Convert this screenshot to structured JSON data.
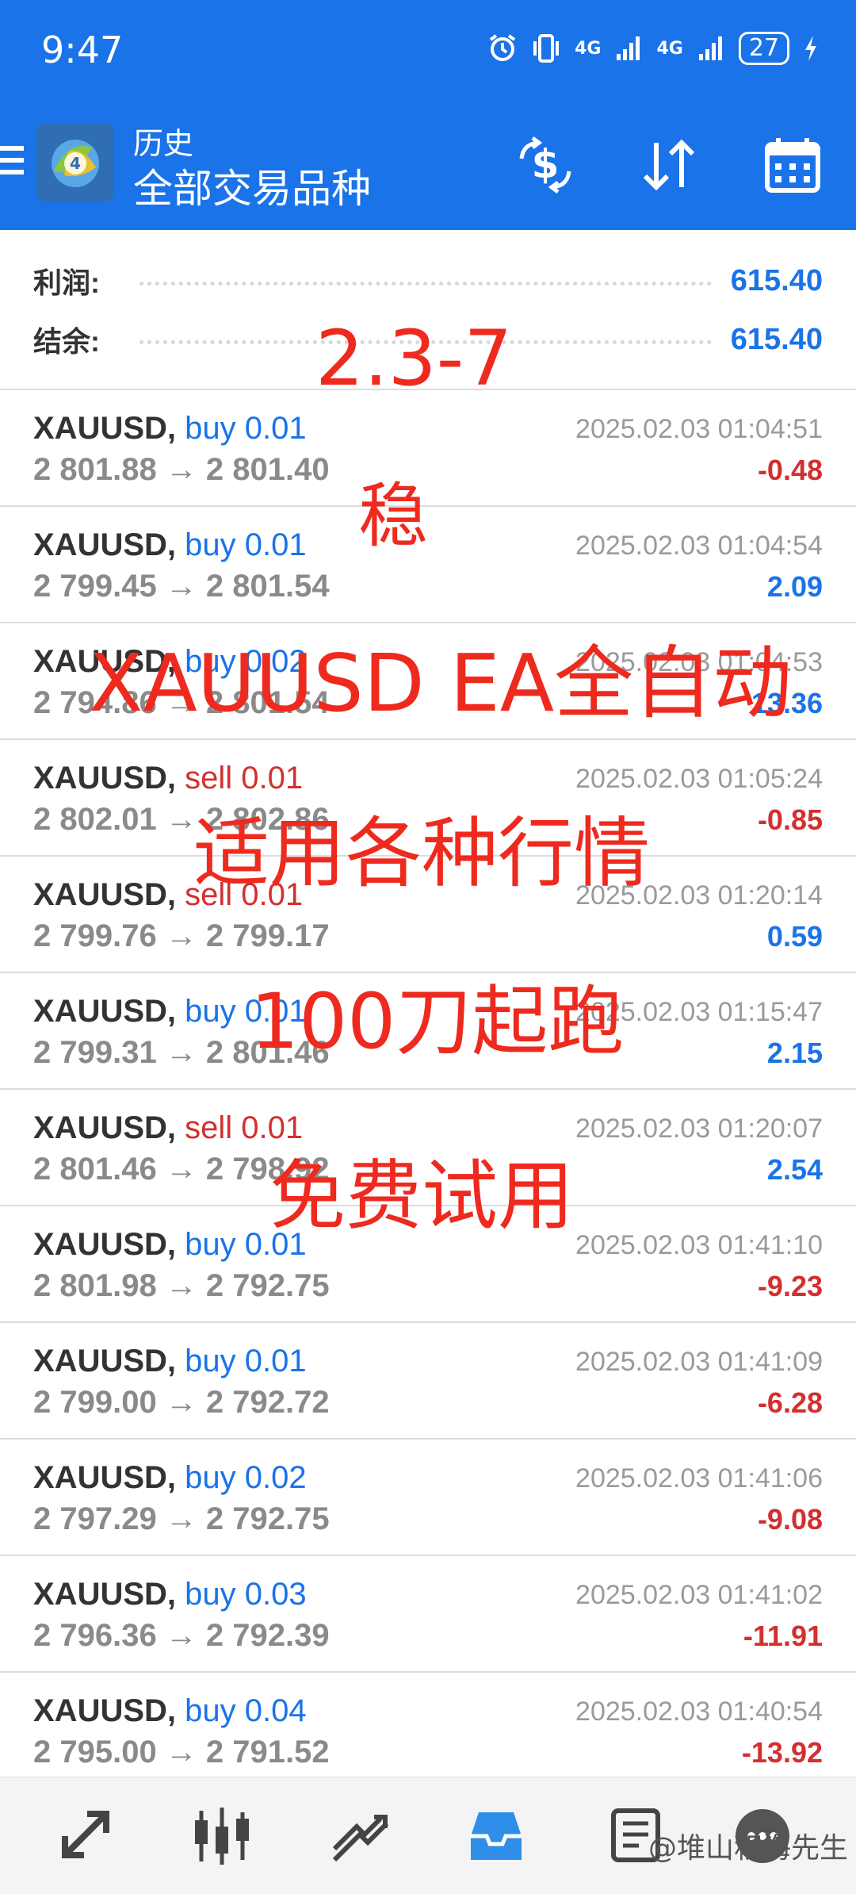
{
  "status_bar": {
    "time": "9:47",
    "icons": [
      "alarm-icon",
      "vibrate-icon",
      "signal-4g-icon",
      "signal-4g-icon"
    ],
    "network_label_1": "4G",
    "network_label_2": "4G",
    "battery": "27"
  },
  "toolbar": {
    "subtitle": "历史",
    "title": "全部交易品种",
    "actions": [
      "currency-exchange-icon",
      "sort-icon",
      "calendar-icon"
    ]
  },
  "summary": {
    "profit_label": "利润:",
    "profit_value": "615.40",
    "balance_label": "结余:",
    "balance_value": "615.40"
  },
  "deals": [
    {
      "symbol": "XAUUSD,",
      "side": "buy 0.01",
      "type": "buy",
      "prices": "2 801.88 → 2 801.40",
      "time": "2025.02.03 01:04:51",
      "profit": "-0.48",
      "sign": "neg"
    },
    {
      "symbol": "XAUUSD,",
      "side": "buy 0.01",
      "type": "buy",
      "prices": "2 799.45 → 2 801.54",
      "time": "2025.02.03 01:04:54",
      "profit": "2.09",
      "sign": "pos"
    },
    {
      "symbol": "XAUUSD,",
      "side": "buy 0.02",
      "type": "buy",
      "prices": "2 794.86 → 2 801.54",
      "time": "2025.02.03 01:04:53",
      "profit": "13.36",
      "sign": "pos"
    },
    {
      "symbol": "XAUUSD,",
      "side": "sell 0.01",
      "type": "sell",
      "prices": "2 802.01 → 2 802.86",
      "time": "2025.02.03 01:05:24",
      "profit": "-0.85",
      "sign": "neg"
    },
    {
      "symbol": "XAUUSD,",
      "side": "sell 0.01",
      "type": "sell",
      "prices": "2 799.76 → 2 799.17",
      "time": "2025.02.03 01:20:14",
      "profit": "0.59",
      "sign": "pos"
    },
    {
      "symbol": "XAUUSD,",
      "side": "buy 0.01",
      "type": "buy",
      "prices": "2 799.31 → 2 801.46",
      "time": "2025.02.03 01:15:47",
      "profit": "2.15",
      "sign": "pos"
    },
    {
      "symbol": "XAUUSD,",
      "side": "sell 0.01",
      "type": "sell",
      "prices": "2 801.46 → 2 798.92",
      "time": "2025.02.03 01:20:07",
      "profit": "2.54",
      "sign": "pos"
    },
    {
      "symbol": "XAUUSD,",
      "side": "buy 0.01",
      "type": "buy",
      "prices": "2 801.98 → 2 792.75",
      "time": "2025.02.03 01:41:10",
      "profit": "-9.23",
      "sign": "neg"
    },
    {
      "symbol": "XAUUSD,",
      "side": "buy 0.01",
      "type": "buy",
      "prices": "2 799.00 → 2 792.72",
      "time": "2025.02.03 01:41:09",
      "profit": "-6.28",
      "sign": "neg"
    },
    {
      "symbol": "XAUUSD,",
      "side": "buy 0.02",
      "type": "buy",
      "prices": "2 797.29 → 2 792.75",
      "time": "2025.02.03 01:41:06",
      "profit": "-9.08",
      "sign": "neg"
    },
    {
      "symbol": "XAUUSD,",
      "side": "buy 0.03",
      "type": "buy",
      "prices": "2 796.36 → 2 792.39",
      "time": "2025.02.03 01:41:02",
      "profit": "-11.91",
      "sign": "neg"
    },
    {
      "symbol": "XAUUSD,",
      "side": "buy 0.04",
      "type": "buy",
      "prices": "2 795.00 → 2 791.52",
      "time": "2025.02.03 01:40:54",
      "profit": "-13.92",
      "sign": "neg"
    }
  ],
  "overlay": {
    "line1": "2.3-7",
    "line2": "稳",
    "line3": "XAUUSD EA全自动",
    "line4": "适用各种行情",
    "line5": "100刀起跑",
    "line6": "免费试用"
  },
  "bottom_nav": {
    "items": [
      "quotes-icon",
      "chart-icon",
      "trade-icon",
      "history-icon",
      "news-icon",
      "chat-icon"
    ],
    "active": "history-icon",
    "watermark": "@堆山积海先生"
  },
  "colors": {
    "header_blue": "#1a73e8",
    "profit_blue": "#1a73e8",
    "loss_red": "#d32f2f",
    "overlay_red": "#ee2a1f"
  }
}
